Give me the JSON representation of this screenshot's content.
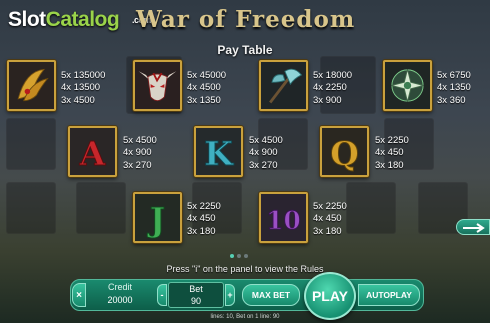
{
  "branding": {
    "logo_part1": "Slot",
    "logo_part2": "Catalog",
    "logo_com": ".com",
    "game_title": "War of Freedom"
  },
  "paytable": {
    "title": "Pay Table",
    "symbols": [
      {
        "name": "golden-claw-icon",
        "pays": [
          "5x 135000",
          "4x 13500",
          "3x 4500"
        ]
      },
      {
        "name": "bull-skull-icon",
        "pays": [
          "5x 45000",
          "4x 4500",
          "3x 1350"
        ]
      },
      {
        "name": "battle-axe-icon",
        "pays": [
          "5x 18000",
          "4x 2250",
          "3x 900"
        ]
      },
      {
        "name": "shuriken-icon",
        "pays": [
          "5x 6750",
          "4x 1350",
          "3x 360"
        ]
      },
      {
        "name": "letter-a-icon",
        "pays": [
          "5x 4500",
          "4x 900",
          "3x 270"
        ]
      },
      {
        "name": "letter-k-icon",
        "pays": [
          "5x 4500",
          "4x 900",
          "3x 270"
        ]
      },
      {
        "name": "letter-q-icon",
        "pays": [
          "5x 2250",
          "4x 450",
          "3x 180"
        ]
      },
      {
        "name": "letter-j-icon",
        "pays": [
          "5x 2250",
          "4x 450",
          "3x 180"
        ]
      },
      {
        "name": "number-10-icon",
        "pays": [
          "5x 2250",
          "4x 450",
          "3x 180"
        ]
      }
    ]
  },
  "pagination": {
    "pages": 3,
    "current": 1
  },
  "rules_hint": "Press \"i\" on the panel to view the Rules",
  "controls": {
    "close_label": "×",
    "credit_label": "Credit",
    "credit_value": "20000",
    "minus_label": "-",
    "bet_label": "Bet",
    "bet_value": "90",
    "plus_label": "+",
    "maxbet_label": "MAX BET",
    "play_label": "PLAY",
    "autoplay_label": "AUTOPLAY"
  },
  "info_line": "lines: 10,  Bet on 1 line: 90",
  "colors": {
    "frame_gold": "#c9a13d",
    "panel_green": "#178a6c",
    "title_gold": "#d8c58b"
  }
}
